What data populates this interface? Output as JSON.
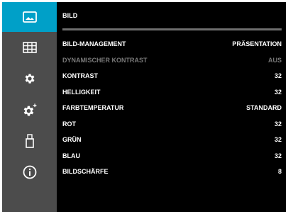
{
  "sidebar": {
    "items": [
      {
        "icon": "picture-icon",
        "active": true
      },
      {
        "icon": "grid-layout-icon",
        "active": false
      },
      {
        "icon": "gear-icon",
        "active": false
      },
      {
        "icon": "gear-plus-icon",
        "active": false
      },
      {
        "icon": "usb-icon",
        "active": false
      },
      {
        "icon": "info-icon",
        "active": false
      }
    ]
  },
  "panel": {
    "title": "BILD",
    "rows": [
      {
        "label": "BILD-MANAGEMENT",
        "value": "PRÄSENTATION",
        "disabled": false
      },
      {
        "label": "DYNAMISCHER KONTRAST",
        "value": "AUS",
        "disabled": true
      },
      {
        "label": "KONTRAST",
        "value": "32",
        "disabled": false
      },
      {
        "label": "HELLIGKEIT",
        "value": "32",
        "disabled": false
      },
      {
        "label": "FARBTEMPERATUR",
        "value": "STANDARD",
        "disabled": false
      },
      {
        "label": "ROT",
        "value": "32",
        "disabled": false
      },
      {
        "label": "GRÜN",
        "value": "32",
        "disabled": false
      },
      {
        "label": "BLAU",
        "value": "32",
        "disabled": false
      },
      {
        "label": "BILDSCHÄRFE",
        "value": "8",
        "disabled": false
      }
    ]
  },
  "colors": {
    "accent": "#00a0c8",
    "sidebar": "#4c4c4c",
    "background": "#000000",
    "disabled_text": "#7a7a7a"
  }
}
